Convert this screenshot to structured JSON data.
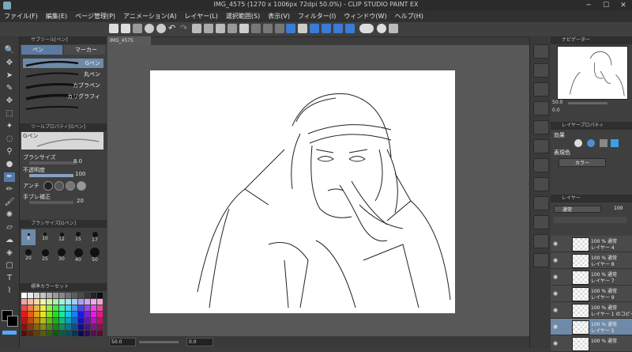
{
  "window": {
    "title": "IMG_4575 (1270 x 1006px 72dpi 50.0%) - CLIP STUDIO PAINT EX"
  },
  "menu": [
    "ファイル(F)",
    "編集(E)",
    "ページ管理(P)",
    "アニメーション(A)",
    "レイヤー(L)",
    "選択範囲(S)",
    "表示(V)",
    "フィルター(I)",
    "ウィンドウ(W)",
    "ヘルプ(H)"
  ],
  "subtool": {
    "header": "サブツール[ペン]",
    "tabs": [
      "ペン",
      "マーカー"
    ],
    "brushes": [
      "Gペン",
      "丸ペン",
      "カブラペン",
      "カリグラフィ",
      ""
    ]
  },
  "toolprop": {
    "header": "ツールプロパティ[Gペン]",
    "brush_label": "Gペン",
    "brush_size_label": "ブラシサイズ",
    "brush_size": "8.0",
    "opacity_label": "不透明度",
    "opacity": "100",
    "aa_label": "アンチ",
    "stabilize_label": "手ブレ補正",
    "stabilize": "20"
  },
  "brushsize": {
    "header": "ブラシサイズ[Gペン]",
    "sizes": [
      "8",
      "10",
      "12",
      "15",
      "17",
      "20",
      "25",
      "30",
      "40",
      "50"
    ]
  },
  "colorset": {
    "header": "標準カラーセット"
  },
  "canvas": {
    "tab": "IMG_4575",
    "zoom": "50.0",
    "angle": "0.0"
  },
  "navigator": {
    "header": "ナビゲーター",
    "zoom": "50.0",
    "angle": "0.0"
  },
  "layerprop": {
    "header": "レイヤープロパティ",
    "effect_label": "効果",
    "color_label": "表現色",
    "color_value": "カラー"
  },
  "layers": {
    "header": "レイヤー",
    "blend": "通常",
    "opacity": "100",
    "items": [
      {
        "line1": "100 % 通常",
        "line2": "レイヤー 4",
        "selected": false
      },
      {
        "line1": "100 % 通常",
        "line2": "レイヤー 8",
        "selected": false
      },
      {
        "line1": "100 % 通常",
        "line2": "レイヤー 7",
        "selected": false
      },
      {
        "line1": "100 % 通常",
        "line2": "レイヤー 9",
        "selected": false
      },
      {
        "line1": "100 % 通常",
        "line2": "レイヤー 1 のコピー",
        "selected": false
      },
      {
        "line1": "100 % 通常",
        "line2": "レイヤー 5",
        "selected": true
      },
      {
        "line1": "100 % 通常",
        "line2": "",
        "selected": false
      }
    ]
  }
}
